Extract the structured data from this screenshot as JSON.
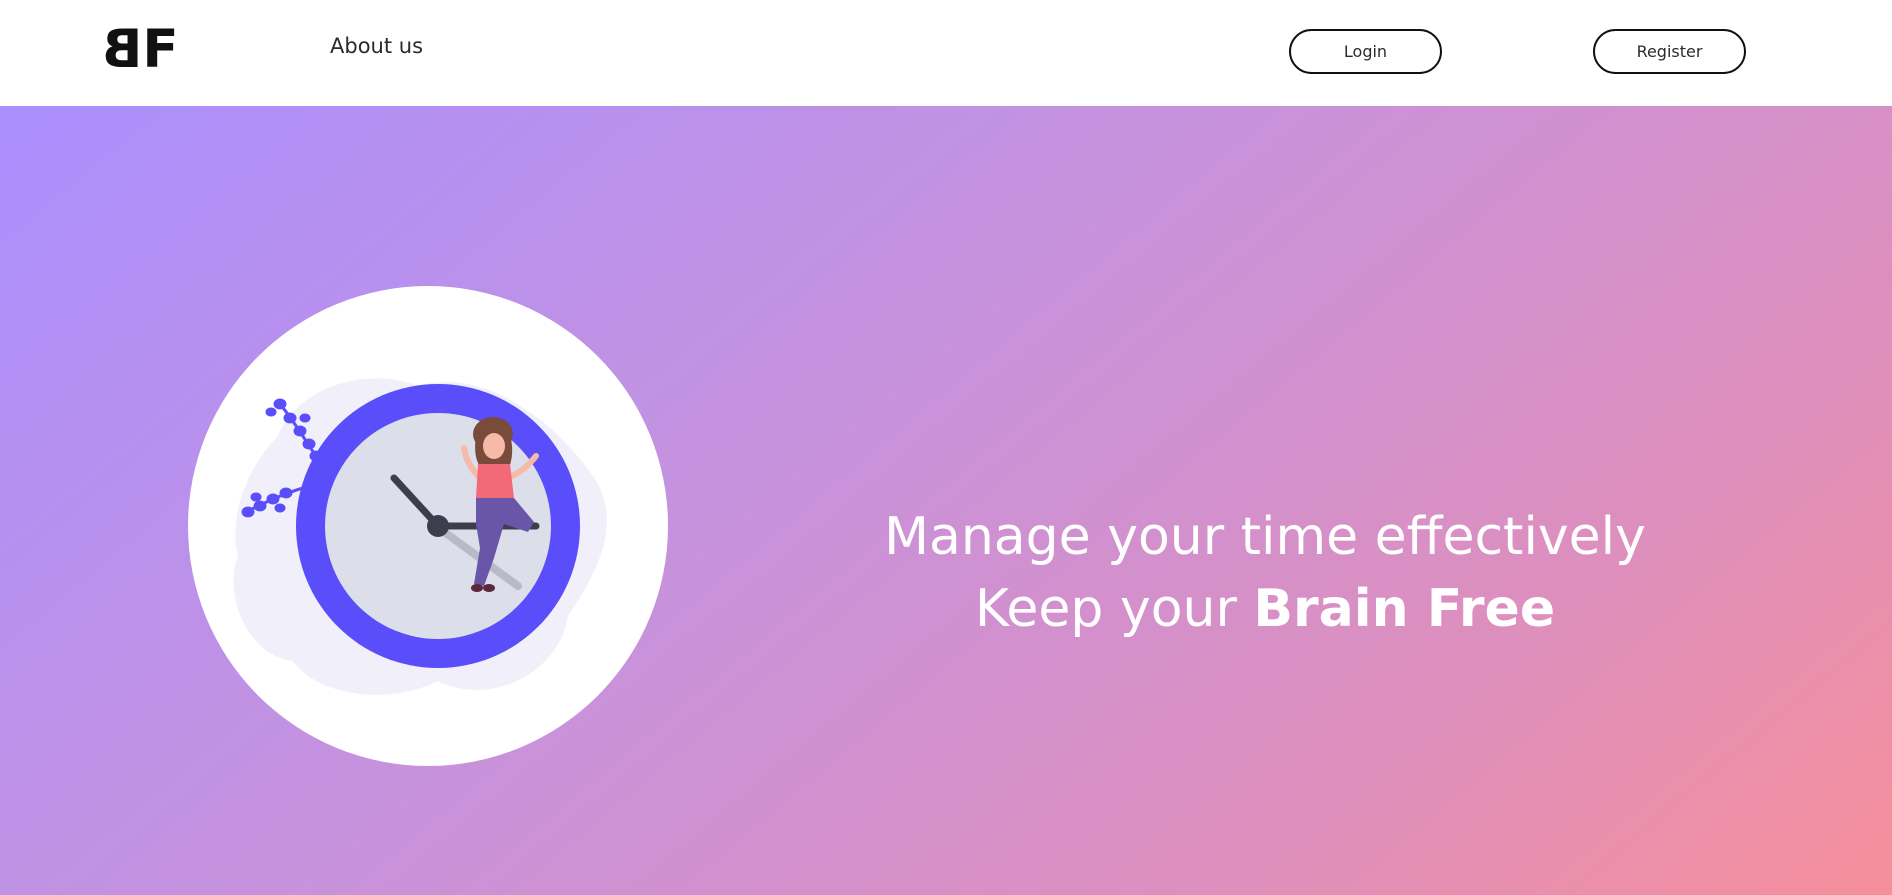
{
  "navbar": {
    "logo_text": "BF",
    "logo_first": "B",
    "logo_second": "F",
    "about_label": "About us",
    "login_label": "Login",
    "register_label": "Register"
  },
  "hero": {
    "line1": "Manage your time effectively",
    "line2_prefix": "Keep your ",
    "line2_strong": "Brain Free"
  },
  "illustration": {
    "name": "woman-sitting-on-clock-illustration",
    "colors": {
      "circle": "#ffffff",
      "blob": "#f0effa",
      "clock_ring": "#5a4efa",
      "clock_face": "#dcdeea",
      "hands": "#3d3d4d",
      "shirt": "#f26a78",
      "pants": "#6a56a8",
      "hair": "#7a4a3a",
      "leaves": "#5a4efa"
    }
  },
  "theme": {
    "gradient_start": "#aa8ffe",
    "gradient_end": "#f68f9b",
    "text_light": "#ffffff",
    "text_dark": "#2b2b2b"
  }
}
